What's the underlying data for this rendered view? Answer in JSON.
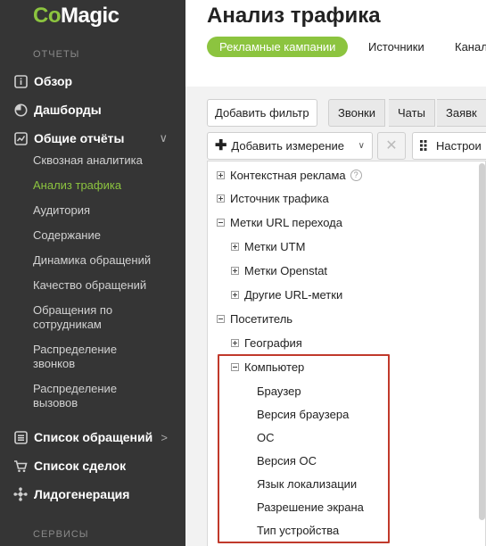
{
  "logo": {
    "co": "Co",
    "magic": "Magic"
  },
  "sidebar": {
    "section_reports": "ОТЧЕТЫ",
    "section_services": "СЕРВИСЫ",
    "items": [
      {
        "label": "Обзор",
        "icon": "info-icon"
      },
      {
        "label": "Дашборды",
        "icon": "pie-chart-icon"
      },
      {
        "label": "Общие отчёты",
        "icon": "chart-icon",
        "arrow": "∨"
      },
      {
        "label": "Список обращений",
        "icon": "list-icon",
        "arrow": ">"
      },
      {
        "label": "Список сделок",
        "icon": "cart-icon"
      },
      {
        "label": "Лидогенерация",
        "icon": "network-icon"
      }
    ],
    "subitems": [
      "Сквозная аналитика",
      "Анализ трафика",
      "Аудитория",
      "Содержание",
      "Динамика обращений",
      "Качество обращений",
      "Обращения по сотрудникам",
      "Распределение звонков",
      "Распределение вызовов"
    ]
  },
  "main": {
    "title": "Анализ трафика",
    "tabs": [
      "Рекламные кампании",
      "Источники",
      "Канал"
    ],
    "add_filter": "Добавить фильтр",
    "segments": [
      "Звонки",
      "Чаты",
      "Заявк"
    ],
    "add_dimension": "Добавить измерение",
    "settings": "Настрои",
    "tree": [
      {
        "label": "Контекстная реклама",
        "state": "plus",
        "level": 0,
        "help": "?"
      },
      {
        "label": "Источник трафика",
        "state": "plus",
        "level": 0
      },
      {
        "label": "Метки URL перехода",
        "state": "minus",
        "level": 0
      },
      {
        "label": "Метки UTM",
        "state": "plus",
        "level": 1
      },
      {
        "label": "Метки Openstat",
        "state": "plus",
        "level": 1
      },
      {
        "label": "Другие URL-метки",
        "state": "plus",
        "level": 1
      },
      {
        "label": "Посетитель",
        "state": "minus",
        "level": 0
      },
      {
        "label": "География",
        "state": "plus",
        "level": 1
      },
      {
        "label": "Компьютер",
        "state": "minus",
        "level": 1
      },
      {
        "label": "Браузер",
        "state": "none",
        "level": 2
      },
      {
        "label": "Версия браузера",
        "state": "none",
        "level": 2
      },
      {
        "label": "ОС",
        "state": "none",
        "level": 2
      },
      {
        "label": "Версия ОС",
        "state": "none",
        "level": 2
      },
      {
        "label": "Язык локализации",
        "state": "none",
        "level": 2
      },
      {
        "label": "Разрешение экрана",
        "state": "none",
        "level": 2
      },
      {
        "label": "Тип устройства",
        "state": "none",
        "level": 2
      }
    ]
  },
  "colors": {
    "brand_green": "#8cc43f",
    "sidebar_bg": "#353535",
    "highlight": "#c0392b"
  }
}
